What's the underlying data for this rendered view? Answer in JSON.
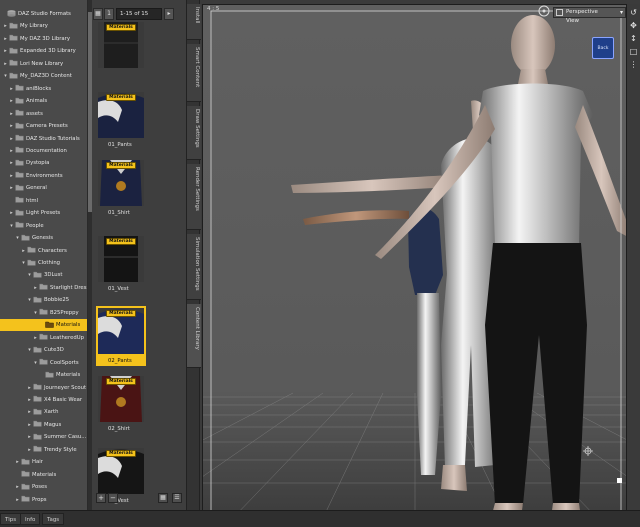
{
  "tree": {
    "items": [
      {
        "label": "DAZ Studio Formats",
        "expander": "",
        "icon": "database-icon"
      },
      {
        "label": "My Library",
        "expander": "▸",
        "icon": "folder-icon"
      },
      {
        "label": "My DAZ 3D Library",
        "expander": "▸",
        "icon": "folder-icon"
      },
      {
        "label": "Expanded 3D Library",
        "expander": "▸",
        "icon": "folder-icon"
      },
      {
        "label": "Lori New Library",
        "expander": "▸",
        "icon": "folder-icon"
      },
      {
        "label": "My_DAZ3D Content",
        "expander": "▾",
        "icon": "folder-icon"
      },
      {
        "label": "aniBlocks",
        "expander": "▸",
        "icon": "folder-icon"
      },
      {
        "label": "Animals",
        "expander": "▸",
        "icon": "folder-icon"
      },
      {
        "label": "assets",
        "expander": "▸",
        "icon": "folder-icon"
      },
      {
        "label": "Camera Presets",
        "expander": "▸",
        "icon": "folder-icon"
      },
      {
        "label": "DAZ Studio Tutorials",
        "expander": "▸",
        "icon": "folder-icon"
      },
      {
        "label": "Documentation",
        "expander": "▸",
        "icon": "folder-icon"
      },
      {
        "label": "Dystopia",
        "expander": "▸",
        "icon": "folder-icon"
      },
      {
        "label": "Environments",
        "expander": "▸",
        "icon": "folder-icon"
      },
      {
        "label": "General",
        "expander": "▸",
        "icon": "folder-icon"
      },
      {
        "label": "html",
        "expander": "",
        "icon": "folder-icon"
      },
      {
        "label": "Light Presets",
        "expander": "▸",
        "icon": "folder-icon"
      },
      {
        "label": "People",
        "expander": "▾",
        "icon": "folder-icon"
      },
      {
        "label": "Genesis",
        "expander": "▾",
        "icon": "folder-icon"
      },
      {
        "label": "Characters",
        "expander": "▸",
        "icon": "folder-icon"
      },
      {
        "label": "Clothing",
        "expander": "▾",
        "icon": "folder-icon"
      },
      {
        "label": "3DLust",
        "expander": "▾",
        "icon": "folder-icon"
      },
      {
        "label": "Starlight Dress",
        "expander": "▸",
        "icon": "folder-icon"
      },
      {
        "label": "Bobbie25",
        "expander": "▾",
        "icon": "folder-icon"
      },
      {
        "label": "B25Preppy",
        "expander": "▾",
        "icon": "folder-icon"
      },
      {
        "label": "Materials",
        "expander": "",
        "icon": "folder-icon",
        "selected": true
      },
      {
        "label": "LeatheredUp",
        "expander": "▸",
        "icon": "folder-icon"
      },
      {
        "label": "Cute3D",
        "expander": "▾",
        "icon": "folder-icon"
      },
      {
        "label": "CoolSports",
        "expander": "▾",
        "icon": "folder-icon"
      },
      {
        "label": "Materials",
        "expander": "",
        "icon": "folder-icon"
      },
      {
        "label": "Journeyer Scout",
        "expander": "▸",
        "icon": "folder-icon"
      },
      {
        "label": "X4 Basic Wear",
        "expander": "▸",
        "icon": "folder-icon"
      },
      {
        "label": "Xarth",
        "expander": "▸",
        "icon": "folder-icon"
      },
      {
        "label": "Magus",
        "expander": "▸",
        "icon": "folder-icon"
      },
      {
        "label": "Summer Casu...",
        "expander": "▸",
        "icon": "folder-icon"
      },
      {
        "label": "Trendy Style",
        "expander": "▸",
        "icon": "folder-icon"
      },
      {
        "label": "Hair",
        "expander": "▸",
        "icon": "folder-icon"
      },
      {
        "label": "Materials",
        "expander": "",
        "icon": "folder-icon"
      },
      {
        "label": "Poses",
        "expander": "▸",
        "icon": "folder-icon"
      },
      {
        "label": "Props",
        "expander": "▸",
        "icon": "folder-icon"
      }
    ]
  },
  "thumbs": {
    "page_num": "1",
    "range": "1-15 of 15",
    "badge": "Materials",
    "items": [
      {
        "label": "",
        "kind": "pants"
      },
      {
        "label": "01_Pants",
        "kind": "shirt"
      },
      {
        "label": "01_Shirt",
        "kind": "vest"
      },
      {
        "label": "01_Vest",
        "kind": "pants2"
      },
      {
        "label": "02_Pants",
        "kind": "shirt2",
        "selected": true
      },
      {
        "label": "02_Shirt",
        "kind": "vest2"
      },
      {
        "label": "02_Vest",
        "kind": "shirt3"
      }
    ],
    "add_label": "+",
    "remove_label": "−"
  },
  "vtabs": [
    "Install",
    "Smart Content",
    "Draw Settings",
    "Render Settings",
    "Simulation Settings",
    "Content Library"
  ],
  "bottom_tabs": [
    "Tips",
    "Info",
    "Tags"
  ],
  "viewport": {
    "aspect_label": "4 : 5",
    "camera": "Perspective View",
    "cube_label": "Back"
  },
  "colors": {
    "accent": "#f4c21c",
    "panel": "#4a4a4a",
    "viewport_bg": "#5e5e5e"
  }
}
